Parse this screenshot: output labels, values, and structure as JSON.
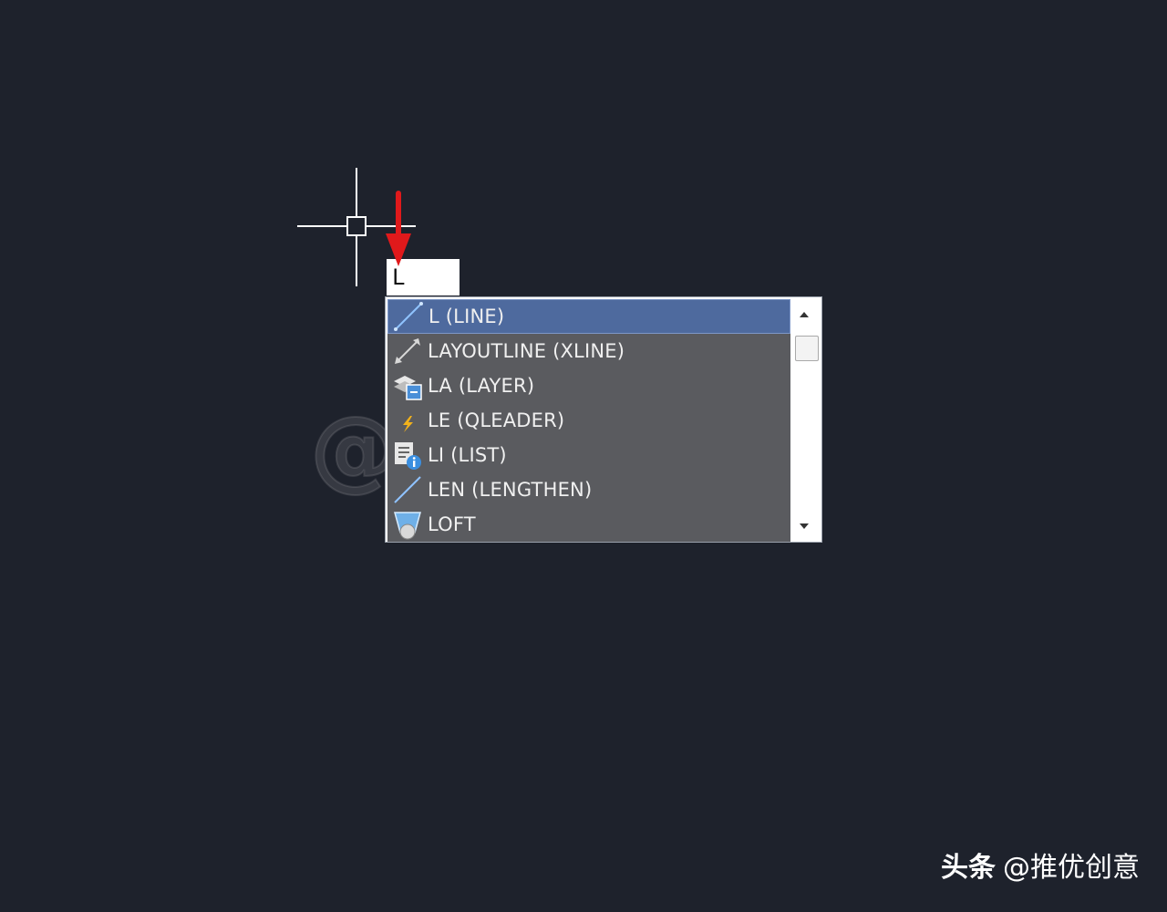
{
  "app": {
    "canvas_background": "#1e222c"
  },
  "dynamic_input": {
    "value": "L"
  },
  "autocomplete": {
    "items": [
      {
        "label": "L (LINE)",
        "icon": "line-icon",
        "selected": true
      },
      {
        "label": "LAYOUTLINE (XLINE)",
        "icon": "xline-icon",
        "selected": false
      },
      {
        "label": "LA (LAYER)",
        "icon": "layer-icon",
        "selected": false
      },
      {
        "label": "LE (QLEADER)",
        "icon": "qleader-icon",
        "selected": false
      },
      {
        "label": "LI (LIST)",
        "icon": "list-icon",
        "selected": false
      },
      {
        "label": "LEN (LENGTHEN)",
        "icon": "lengthen-icon",
        "selected": false
      },
      {
        "label": "LOFT",
        "icon": "loft-icon",
        "selected": false
      }
    ],
    "selected_color": "#4e6a9e",
    "list_background": "#5a5b5f"
  },
  "annotation": {
    "arrow_color": "#e0191b"
  },
  "watermark": {
    "text": "@推优创意"
  },
  "credit": {
    "brand": "头条",
    "handle": "@推优创意"
  }
}
